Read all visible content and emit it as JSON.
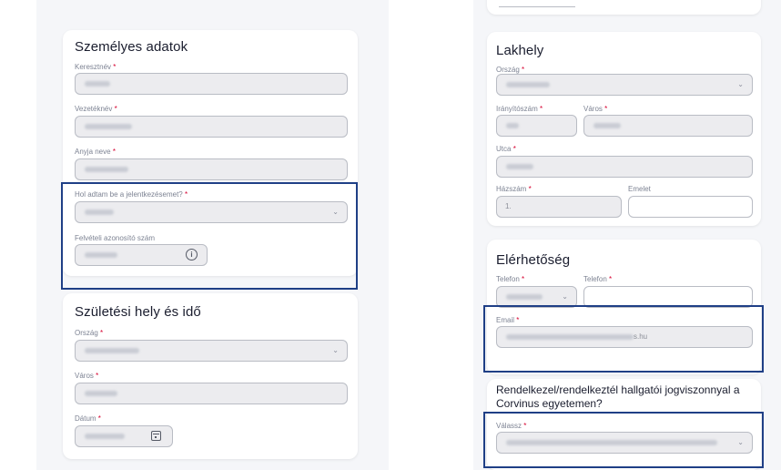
{
  "personal": {
    "title": "Személyes adatok",
    "first_name_label": "Keresztnév",
    "last_name_label": "Vezetéknév",
    "mother_name_label": "Anyja neve",
    "application_label": "Hol adtam be a jelentkezésemet?",
    "admission_id_label": "Felvételi azonosító szám"
  },
  "birth": {
    "title": "Születési hely és idő",
    "country_label": "Ország",
    "city_label": "Város",
    "date_label": "Dátum"
  },
  "residence": {
    "title": "Lakhely",
    "country_label": "Ország",
    "zip_label": "Irányítószám",
    "city_label": "Város",
    "street_label": "Utca",
    "house_label": "Házszám",
    "floor_label": "Emelet",
    "house_value": "1."
  },
  "contact": {
    "title": "Elérhetőség",
    "phone_prefix_label": "Telefon",
    "phone_label": "Telefon",
    "email_label": "Email",
    "email_suffix": "s.hu"
  },
  "corvinus": {
    "question": "Rendelkezel/rendelkeztél hallgatói jogviszonnyal a Corvinus egyetemen?",
    "select_label": "Válassz"
  },
  "required_mark": "*",
  "icons": {
    "info": "i"
  },
  "colors": {
    "highlight": "#1f3f86",
    "required": "#d6002f"
  }
}
